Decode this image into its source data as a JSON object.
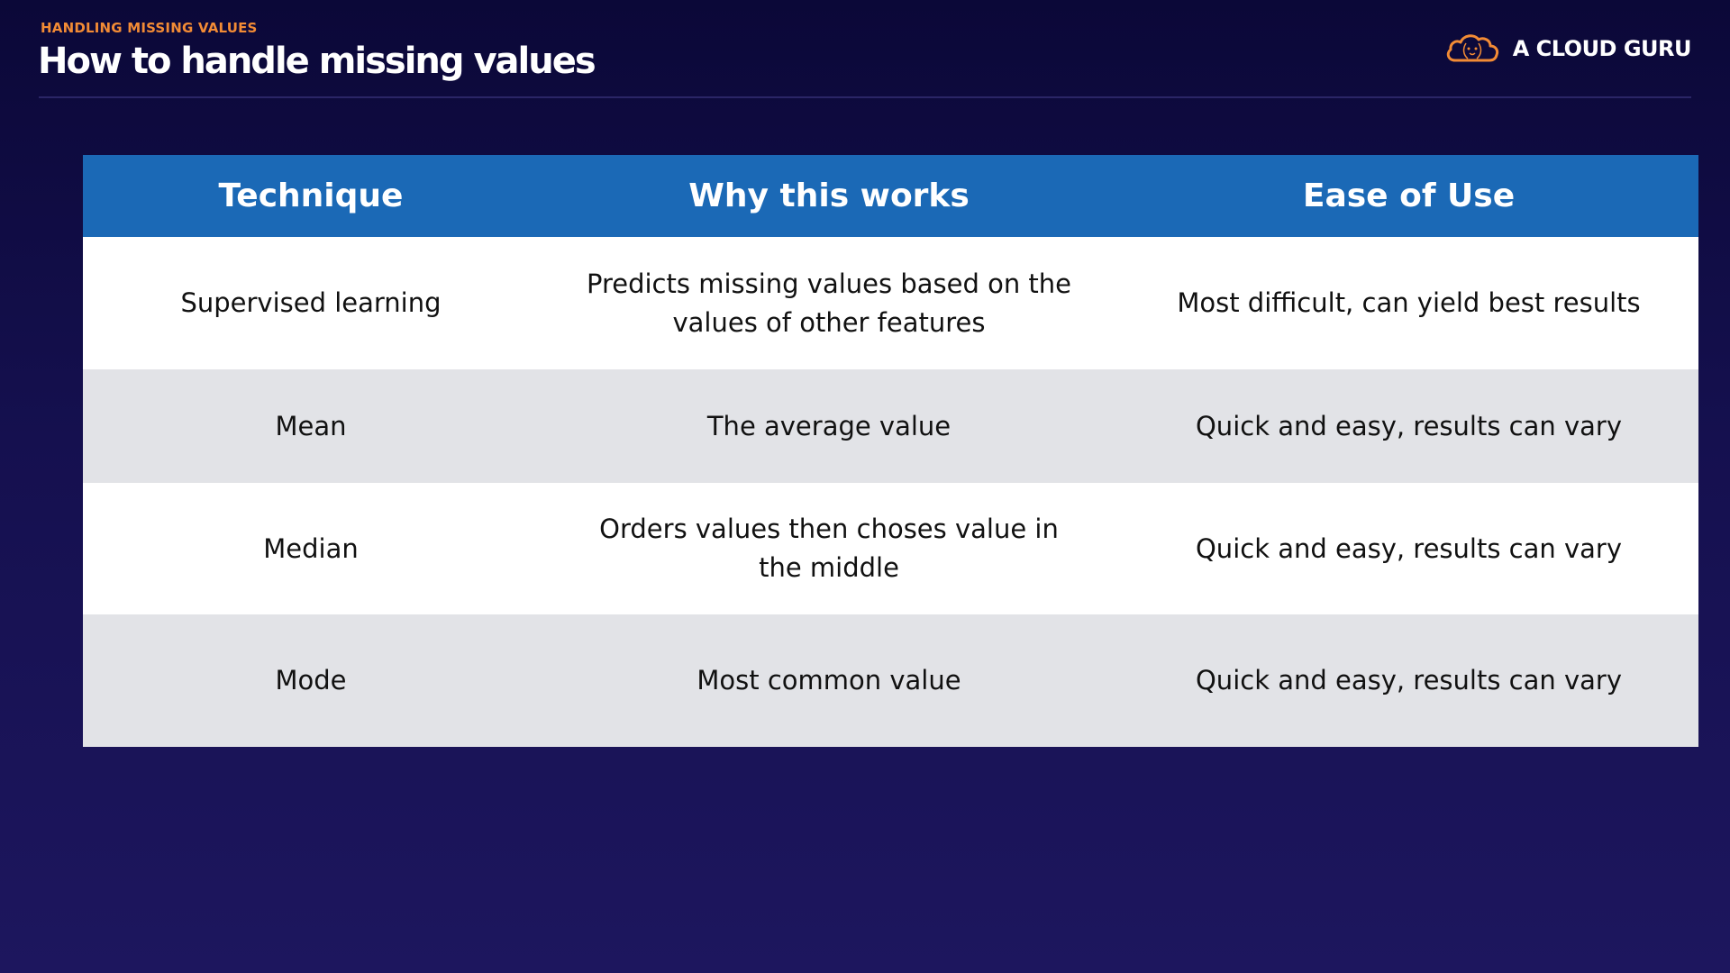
{
  "header": {
    "eyebrow": "HANDLING MISSING VALUES",
    "title": "How to handle missing values",
    "brand_name": "A CLOUD GURU",
    "brand_icon": "cloud-logo-icon"
  },
  "colors": {
    "background_top": "#0b0838",
    "background_bottom": "#1d165e",
    "accent": "#f28b35",
    "table_header": "#1b69b6",
    "row_alt": "#e2e3e7"
  },
  "table": {
    "columns": [
      "Technique",
      "Why this works",
      "Ease of Use"
    ],
    "rows": [
      [
        "Supervised learning",
        "Predicts missing values based on the values of other features",
        "Most difficult, can yield best results"
      ],
      [
        "Mean",
        "The average value",
        "Quick and easy, results can vary"
      ],
      [
        "Median",
        "Orders values then choses value in the middle",
        "Quick and easy, results can vary"
      ],
      [
        "Mode",
        "Most common value",
        "Quick and easy, results can vary"
      ]
    ]
  }
}
